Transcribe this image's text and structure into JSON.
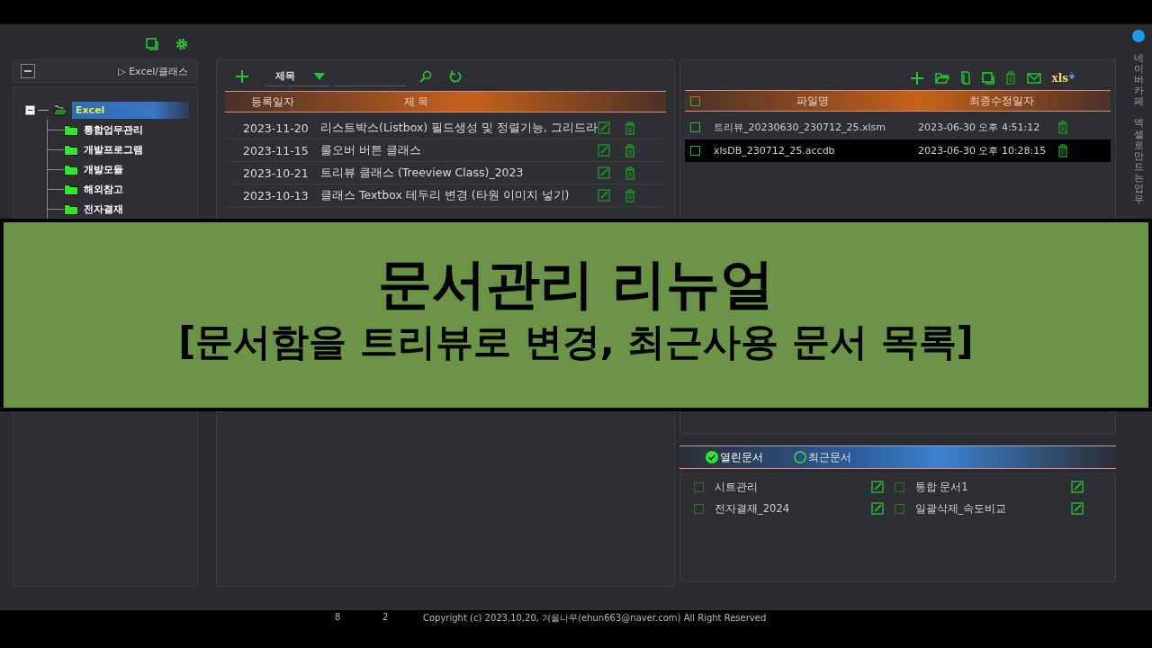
{
  "left_panel": {
    "breadcrumb": "▷ Excel/클래스",
    "tree": [
      {
        "label": "Excel",
        "expanded": true,
        "selected": true,
        "children": [
          {
            "label": "통합업무관리",
            "selected": false
          },
          {
            "label": "개발프로그램",
            "selected": false
          },
          {
            "label": "개발모듈",
            "selected": false
          },
          {
            "label": "해외참고",
            "selected": false
          },
          {
            "label": "전자결재",
            "selected": false
          }
        ]
      }
    ]
  },
  "post_list": {
    "search_field": "제목",
    "columns": [
      "등록일자",
      "제 목"
    ],
    "rows": [
      {
        "date": "2023-11-20",
        "title": "리스트박스(Listbox) 필드생성 및 정렬기능, 그리드라",
        "selected": false
      },
      {
        "date": "2023-11-15",
        "title": "롤오버 버튼 클래스",
        "selected": false
      },
      {
        "date": "2023-10-21",
        "title": "트리뷰 클래스 (Treeview Class)_2023",
        "selected": false
      },
      {
        "date": "2023-10-13",
        "title": "클래스 Textbox 테두리 변경 (타원 이미지 넣기)",
        "selected": false
      }
    ]
  },
  "file_list": {
    "toolbar_label": "xls",
    "select_all_checked": false,
    "columns": [
      "파일명",
      "최종수정일자"
    ],
    "rows": [
      {
        "name": "트리뷰_20230630_230712_25.xlsm",
        "modified": "2023-06-30 오후 4:51:12",
        "checked": false,
        "selected": false
      },
      {
        "name": "xlsDB_230712_25.accdb",
        "modified": "2023-06-30 오후 10:28:15",
        "checked": false,
        "selected": true
      }
    ]
  },
  "doc_tabs": [
    {
      "label": "열린문서",
      "selected": true
    },
    {
      "label": "최근문서",
      "selected": false
    }
  ],
  "documents": [
    {
      "name": "시트관리",
      "checked": false
    },
    {
      "name": "통합 문서1",
      "checked": false
    },
    {
      "name": "전자결재_2024",
      "checked": false
    },
    {
      "name": "일괄삭제_속도비교",
      "checked": false
    }
  ],
  "side_strip": {
    "lines": [
      "네이버카페",
      "엑셀로만드는업무"
    ]
  },
  "footer": {
    "count_1": "8",
    "count_2": "2",
    "copyright": "Copyright (c) 2023,10,20, 겨울나무(ehun663@naver.com)  All Right Reserved"
  },
  "banner": {
    "title": "문서관리 리뉴얼",
    "subtitle": "[문서함을 트리뷰로 변경, 최근사용 문서 목록]"
  }
}
